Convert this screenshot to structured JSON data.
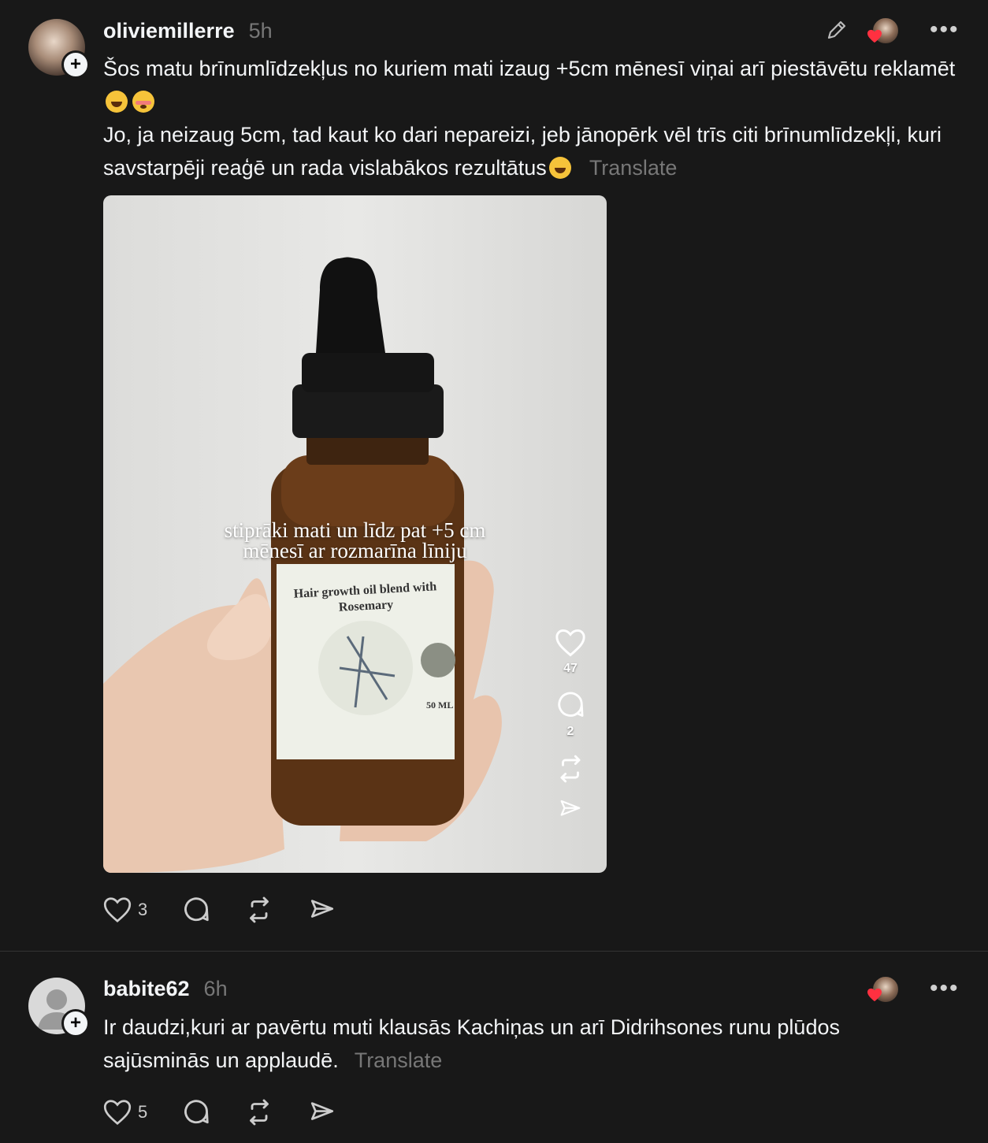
{
  "posts": [
    {
      "username": "oliviemillerre",
      "time": "5h",
      "text_line1": "Šos matu brīnumlīdzekļus no kuriem mati izaug +5cm mēnesī viņai arī piestāvētu reklamēt",
      "emoji1": "laughing-emoji",
      "emoji2": "flushed-emoji",
      "text_line2": "Jo, ja neizaug 5cm, tad kaut ko dari nepareizi, jeb jānopērk vēl trīs citi brīnumlīdzekļi, kuri savstarpēji reaģē un rada vislabākos rezultātus",
      "emoji3": "grinning-emoji",
      "translate": "Translate",
      "media": {
        "overlay_line1": "stiprāki mati un līdz pat +5 cm",
        "overlay_line2": "mēnesī ar rozmarīna līniju",
        "label_line1": "Hair growth oil blend with",
        "label_line2": "Rosemary",
        "label_volume": "50 ML",
        "likes": "47",
        "comments": "2"
      },
      "likes": "3"
    },
    {
      "username": "babite62",
      "time": "6h",
      "text": "Ir daudzi,kuri ar pavērtu muti klausās Kachiņas un arī Didrihsones runu plūdos sajūsminās un applaudē.",
      "translate": "Translate",
      "likes": "5"
    }
  ],
  "colors": {
    "background": "#181818",
    "text": "#f3f5f7",
    "muted": "#777777",
    "heart_red": "#ff3040"
  },
  "icons": [
    "pencil-icon",
    "more-icon",
    "heart-icon",
    "comment-icon",
    "repost-icon",
    "share-icon",
    "plus-icon",
    "heart-reaction-icon"
  ]
}
